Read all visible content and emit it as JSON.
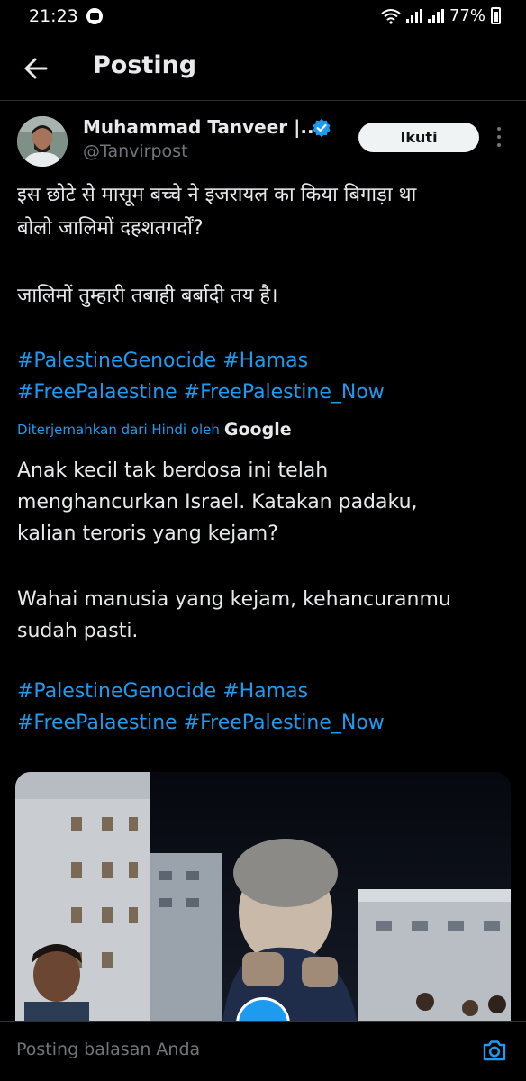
{
  "status_bar": {
    "time": "21:23",
    "battery": "77%"
  },
  "top_bar": {
    "title": "Posting"
  },
  "post": {
    "author_name": "Muhammad Tanveer |...",
    "handle": "@Tanvirpost",
    "follow_label": "Ikuti",
    "original_lines": [
      "इस छोटे से मासूम बच्चे ने इजरायल का किया बिगाड़ा था",
      "बोलो जालिमों दहशतगर्दों?",
      "जालिमों तुम्हारी तबाही बर्बादी तय है।"
    ],
    "original_hashtags": [
      "#PalestineGenocide #Hamas",
      "#FreePalaestine #FreePalestine_Now"
    ],
    "translated_note": "Diterjemahkan dari Hindi oleh",
    "translated_by": "Google",
    "translated_lines": [
      "Anak kecil tak berdosa ini telah",
      "menghancurkan Israel. Katakan padaku,",
      "kalian teroris yang kejam?",
      "Wahai manusia yang kejam, kehancuranmu",
      "sudah pasti."
    ],
    "translated_hashtags": [
      "#PalestineGenocide #Hamas",
      "#FreePalaestine #FreePalestine_Now"
    ]
  },
  "reply": {
    "placeholder": "Posting balasan Anda"
  },
  "colors": {
    "accent": "#1d9bf0",
    "background": "#000000",
    "text": "#e7e9ea",
    "muted": "#71767b"
  }
}
